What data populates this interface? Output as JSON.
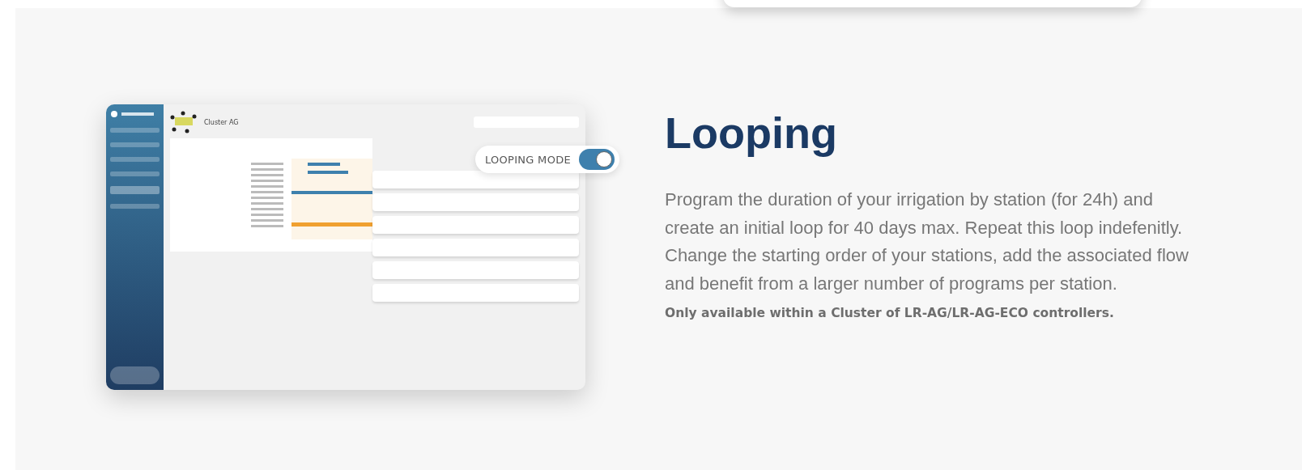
{
  "feature": {
    "title": "Looping",
    "description": "Program the duration of your irrigation by station (for 24h) and create an initial loop for 40 days max. Repeat this loop indefenitly. Change the starting order of your stations, add the associated flow and benefit from a larger number of programs per station.",
    "note": "Only available within a Cluster of LR-AG/LR-AG-ECO controllers."
  },
  "screenshot": {
    "cluster_title": "Cluster AG",
    "looping_toggle": {
      "label": "LOOPING MODE",
      "on": true
    }
  }
}
